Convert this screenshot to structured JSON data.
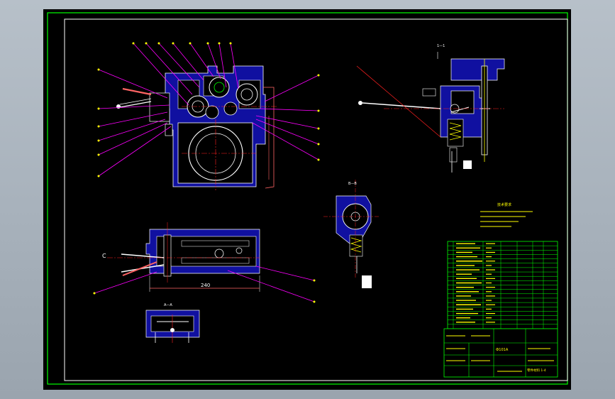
{
  "colors": {
    "desktop": "#a9b3bd",
    "canvas": "#000000",
    "outer_border": "#ffffff",
    "title_border": "#00ff00",
    "section_fill": "#1010a0",
    "part_line": "#ffffff",
    "leader": "#ff00ff",
    "center_line": "#ff2020",
    "annotation": "#ffff00",
    "table_line": "#00ff00",
    "dimension": "#ff6464"
  },
  "drawing": {
    "dimension_label": "240",
    "section_label_left": "C",
    "section_label_aa": "A—A",
    "section_label_bb": "B—B",
    "tech_title": "技术要求"
  },
  "title_block": {
    "title_text": "Ф101A",
    "company_text": "零件材料 1-4"
  }
}
